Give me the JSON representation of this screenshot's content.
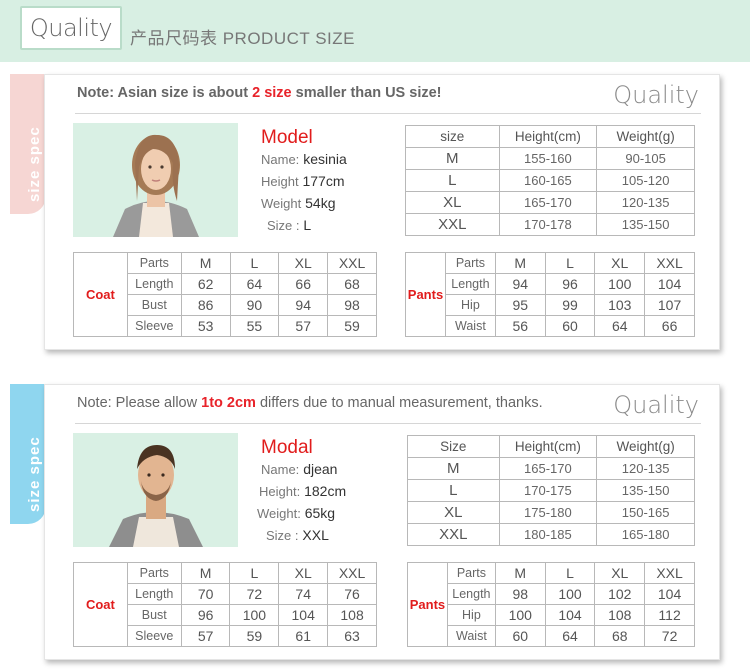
{
  "banner": {
    "tab": "Quality",
    "title": "产品尺码表 PRODUCT  SIZE"
  },
  "colors": {
    "accent_red": "#e11c1c",
    "banner_green": "#d8efe3",
    "tab_pink": "#f6d6d3",
    "tab_blue": "#8fd6ef"
  },
  "sections": [
    {
      "tab_label": "size spec",
      "note_prefix": "Note:  Asian size is about ",
      "note_highlight": "2 size",
      "note_suffix": " smaller than US size!",
      "quality": "Quality",
      "model": {
        "title": "Model",
        "name_label": "Name:",
        "name": "kesinia",
        "height_label": "Height",
        "height": "177cm",
        "weight_label": "Weight",
        "weight": "54kg",
        "size_label": "Size :",
        "size": "L"
      },
      "size_table": {
        "headers": [
          "size",
          "Height(cm)",
          "Weight(g)"
        ],
        "rows": [
          [
            "M",
            "155-160",
            "90-105"
          ],
          [
            "L",
            "160-165",
            "105-120"
          ],
          [
            "XL",
            "165-170",
            "120-135"
          ],
          [
            "XXL",
            "170-178",
            "135-150"
          ]
        ]
      },
      "coat": {
        "label": "Coat",
        "headers": [
          "Parts",
          "M",
          "L",
          "XL",
          "XXL"
        ],
        "rows": [
          [
            "Length",
            "62",
            "64",
            "66",
            "68"
          ],
          [
            "Bust",
            "86",
            "90",
            "94",
            "98"
          ],
          [
            "Sleeve",
            "53",
            "55",
            "57",
            "59"
          ]
        ]
      },
      "pants": {
        "label": "Pants",
        "headers": [
          "Parts",
          "M",
          "L",
          "XL",
          "XXL"
        ],
        "rows": [
          [
            "Length",
            "94",
            "96",
            "100",
            "104"
          ],
          [
            "Hip",
            "95",
            "99",
            "103",
            "107"
          ],
          [
            "Waist",
            "56",
            "60",
            "64",
            "66"
          ]
        ]
      }
    },
    {
      "tab_label": "size spec",
      "note_prefix": "Note: Please allow ",
      "note_highlight": "1to 2cm",
      "note_suffix": " differs due to manual measurement, thanks.",
      "quality": "Quality",
      "model": {
        "title": "Modal",
        "name_label": "Name:",
        "name": "djean",
        "height_label": "Height:",
        "height": "182cm",
        "weight_label": "Weight:",
        "weight": "65kg",
        "size_label": "Size :",
        "size": "XXL"
      },
      "size_table": {
        "headers": [
          "Size",
          "Height(cm)",
          "Weight(g)"
        ],
        "rows": [
          [
            "M",
            "165-170",
            "120-135"
          ],
          [
            "L",
            "170-175",
            "135-150"
          ],
          [
            "XL",
            "175-180",
            "150-165"
          ],
          [
            "XXL",
            "180-185",
            "165-180"
          ]
        ]
      },
      "coat": {
        "label": "Coat",
        "headers": [
          "Parts",
          "M",
          "L",
          "XL",
          "XXL"
        ],
        "rows": [
          [
            "Length",
            "70",
            "72",
            "74",
            "76"
          ],
          [
            "Bust",
            "96",
            "100",
            "104",
            "108"
          ],
          [
            "Sleeve",
            "57",
            "59",
            "61",
            "63"
          ]
        ]
      },
      "pants": {
        "label": "Pants",
        "headers": [
          "Parts",
          "M",
          "L",
          "XL",
          "XXL"
        ],
        "rows": [
          [
            "Length",
            "98",
            "100",
            "102",
            "104"
          ],
          [
            "Hip",
            "100",
            "104",
            "108",
            "112"
          ],
          [
            "Waist",
            "60",
            "64",
            "68",
            "72"
          ]
        ]
      }
    }
  ]
}
